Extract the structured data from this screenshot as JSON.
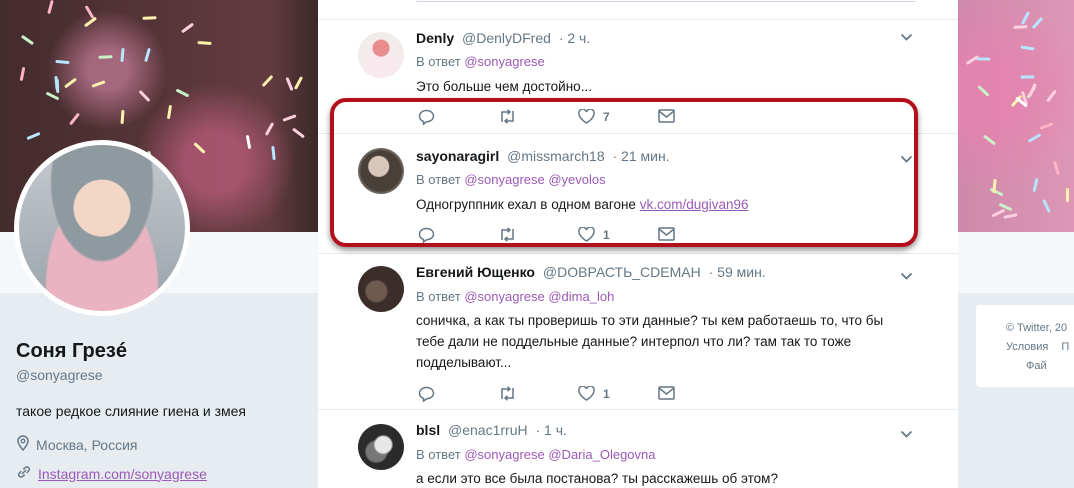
{
  "profile": {
    "name": "Соня Грезé",
    "handle": "@sonyagrese",
    "bio": "такое редкое слияние гиена и змея",
    "location": "Москва, Россия",
    "website": "Instagram.com/sonyagrese"
  },
  "right_card": {
    "line1": "© Twitter, 20",
    "line2": "Условия",
    "line2b": "П",
    "line3": "Фай"
  },
  "tweets": [
    {
      "author": "Denly",
      "handle": "@DenlyDFred",
      "time": "· 2 ч.",
      "reply_prefix": "В ответ",
      "mentions": [
        "@sonyagrese"
      ],
      "text": "Это больше чем достойно...",
      "likes": "7",
      "avatar_color": "#f2ecea"
    },
    {
      "author": "sayonaragirl",
      "handle": "@missmarch18",
      "time": "· 21 мин.",
      "reply_prefix": "В ответ",
      "mentions": [
        "@sonyagrese",
        "@yevolos"
      ],
      "text": "Одногруппник ехал в одном вагоне",
      "link": "vk.com/dugivan96",
      "likes": "1",
      "avatar_color": "#6d6863"
    },
    {
      "author": "Евгений Ющенко",
      "handle": "@DOВРАСТЬ_СDЕМАН",
      "time": "· 59 мин.",
      "reply_prefix": "В ответ",
      "mentions": [
        "@sonyagrese",
        "@dima_loh"
      ],
      "text_lines": [
        "соничка, а как ты проверишь то эти данные? ты кем работаешь то, что бы",
        "тебе дали не поддельные данные? интерпол что ли? там так то тоже",
        "подделывают..."
      ],
      "likes": "1",
      "avatar_color": "#3b2d2a"
    },
    {
      "author": "blsl",
      "handle": "@enac1rruH",
      "time": "· 1 ч.",
      "reply_prefix": "В ответ",
      "mentions": [
        "@sonyagrese",
        "@Daria_Olegovna"
      ],
      "text": "а если это все была постанова? ты расскажешь об этом?",
      "avatar_color": "#2b2b2b"
    }
  ],
  "colors": {
    "accent": "#9b59b6",
    "highlight_border": "#b3101c",
    "muted": "#657786"
  },
  "icons": [
    "reply-icon",
    "retweet-icon",
    "like-icon",
    "direct-message-icon",
    "chevron-down-icon",
    "location-icon",
    "link-icon"
  ]
}
